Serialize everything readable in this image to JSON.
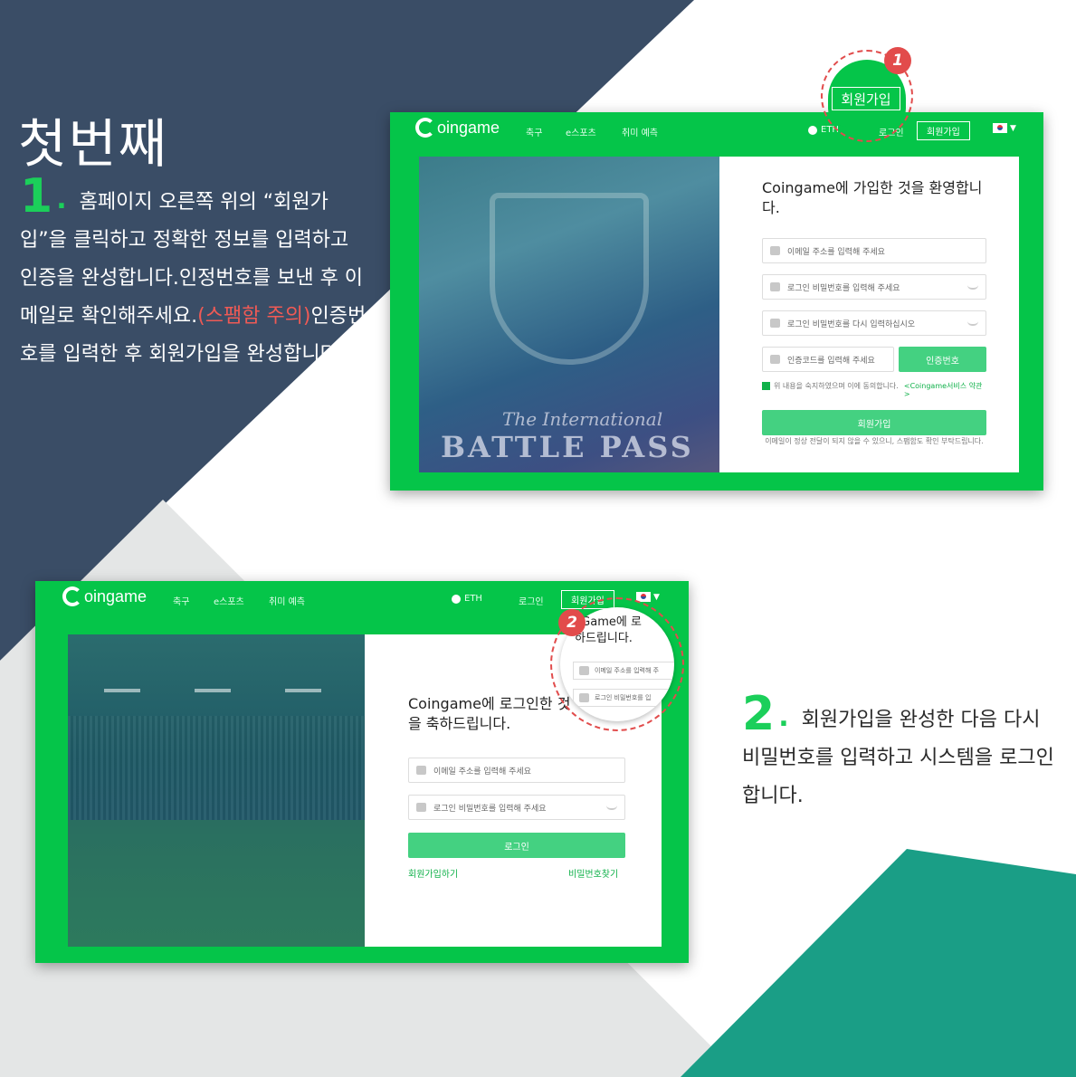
{
  "colors": {
    "navy": "#3a4d66",
    "light_gray": "#e4e6e6",
    "teal": "#1a9e86",
    "brand_green": "#05c549",
    "accent_red": "#e24b4b"
  },
  "step1": {
    "heading": "첫번째",
    "number": "1",
    "text_a": "홈페이지 오른쪽 위의 “회원가입”을 클릭하고 정확한 정보를 입력하고 인증을 완성합니다.인정번호를 보낸 후 이메일로 확인해주세요.",
    "text_warn": "(스팸함 주의)",
    "text_b": "인증번호를 입력한 후 회원가입을 완성합니다."
  },
  "step2": {
    "number": "2",
    "text": "회원가입을 완성한 다음 다시 비밀번호를 입력하고 시스템을 로그인합니다."
  },
  "nav": {
    "logo": "oingame",
    "logo_mark_icon": "coin-c-icon",
    "football": "축구",
    "esports": "e스포츠",
    "hobby": "취미 예측",
    "currency": "ETH",
    "login": "로그인",
    "signup": "회원가입",
    "language_flag_icon": "korea-flag-icon"
  },
  "callout1": {
    "badge": "1",
    "button": "회원가입"
  },
  "callout2": {
    "badge": "2",
    "title_line1": "cGame에 로",
    "title_line2": "하드립니다.",
    "email": "이메일 주소를 입력해 주",
    "password": "로그인 비밀번호를 입"
  },
  "signup_form": {
    "hero_sub": "The International",
    "hero_main": "BATTLE PASS",
    "title": "Coingame에 가입한 것을 환영합니다.",
    "email_placeholder": "이메일 주소를 입력해 주세요",
    "password_placeholder": "로그인 비밀번호를 입력해 주세요",
    "password_confirm_placeholder": "로그인 비밀번호를 다시 입력하십시오",
    "code_placeholder": "인증코드를 입력해 주세요",
    "code_button": "인증번호",
    "agree_text": "위 내용을 숙지하였으며 이에 동의합니다.",
    "agree_link": "<Coingame서비스 약관>",
    "submit": "회원가입",
    "note": "이메일이 정상 전달이 되지 않을 수 있으니, 스팸함도 확인 부탁드립니다."
  },
  "login_form": {
    "title": "Coingame에 로그인한 것을 축하드립니다.",
    "email_placeholder": "이메일 주소를 입력해 주세요",
    "password_placeholder": "로그인 비밀번호를 입력해 주세요",
    "submit": "로그인",
    "signup_link": "회원가입하기",
    "find_password_link": "비밀번호찾기"
  }
}
